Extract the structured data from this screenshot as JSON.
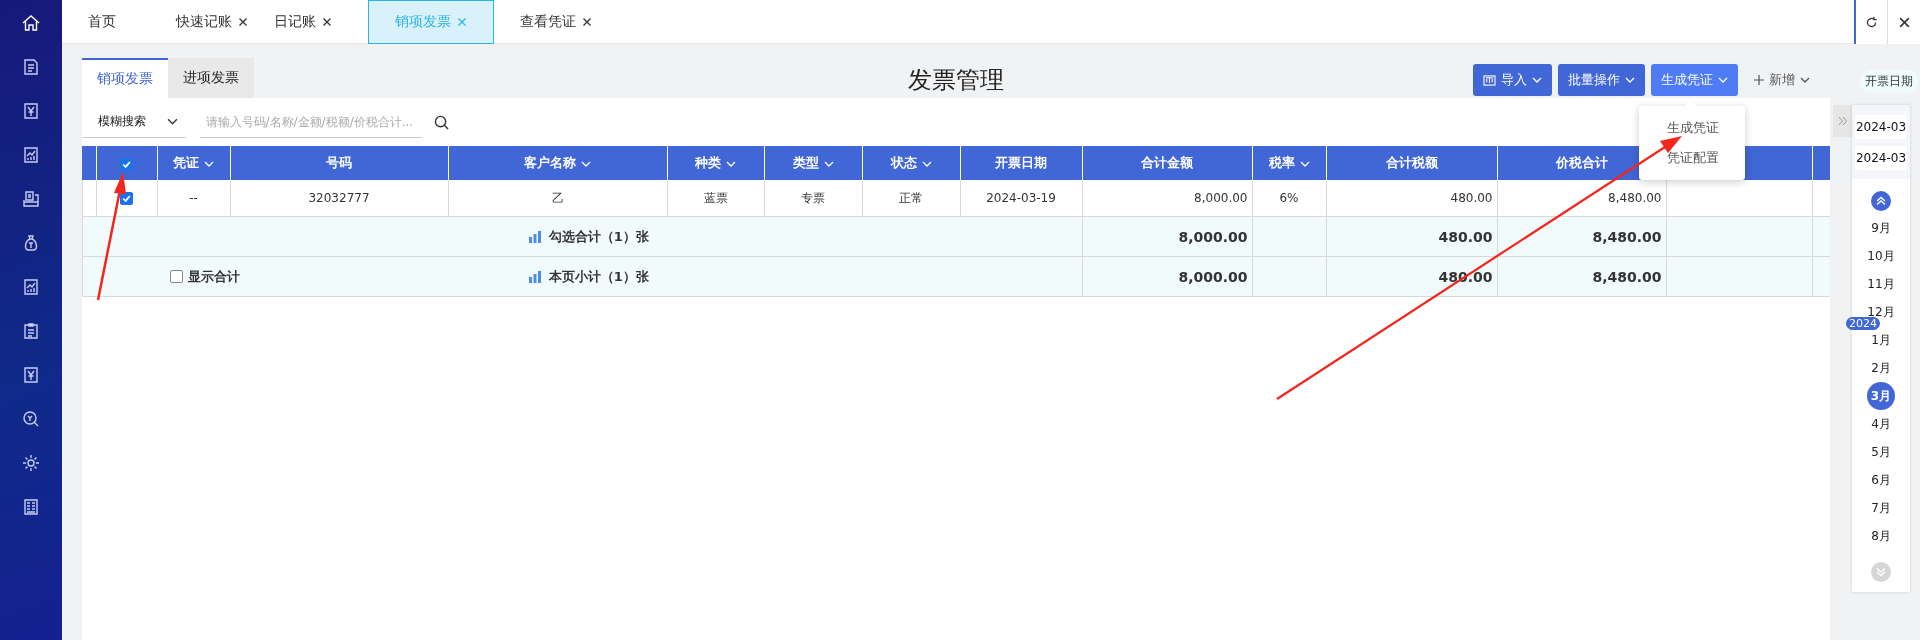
{
  "tabs": [
    {
      "label": "首页",
      "closable": false,
      "selected": false
    },
    {
      "label": "快速记账",
      "closable": true,
      "selected": false
    },
    {
      "label": "日记账",
      "closable": true,
      "selected": false
    },
    {
      "label": "销项发票",
      "closable": true,
      "selected": true
    },
    {
      "label": "查看凭证",
      "closable": true,
      "selected": false
    }
  ],
  "page_title": "发票管理",
  "sub_tabs": [
    {
      "label": "销项发票",
      "selected": true
    },
    {
      "label": "进项发票",
      "selected": false
    }
  ],
  "toolbar": [
    {
      "label": "导入",
      "kind": "import",
      "menu_open": false
    },
    {
      "label": "批量操作",
      "kind": "dropdown",
      "menu_open": false
    },
    {
      "label": "生成凭证",
      "kind": "dropdown",
      "menu_open": true
    },
    {
      "label": "新增",
      "kind": "add",
      "menu_open": false
    }
  ],
  "dropdown_menu": [
    "生成凭证",
    "凭证配置"
  ],
  "search": {
    "mode": "模糊搜索",
    "placeholder": "请输入号码/名称/金额/税额/价税合计..."
  },
  "table": {
    "header_checked": true,
    "columns": [
      {
        "label": "凭证",
        "filter": true
      },
      {
        "label": "号码",
        "filter": false
      },
      {
        "label": "客户名称",
        "filter": true
      },
      {
        "label": "种类",
        "filter": true
      },
      {
        "label": "类型",
        "filter": true
      },
      {
        "label": "状态",
        "filter": true
      },
      {
        "label": "开票日期",
        "filter": false
      },
      {
        "label": "合计金额",
        "filter": false
      },
      {
        "label": "税率",
        "filter": true
      },
      {
        "label": "合计税额",
        "filter": false
      },
      {
        "label": "价税合计",
        "filter": false
      }
    ],
    "rows": [
      {
        "checked": true,
        "cells": [
          "--",
          "32032777",
          "乙",
          "蓝票",
          "专票",
          "正常",
          "2024-03-19",
          "8,000.00",
          "6%",
          "480.00",
          "8,480.00"
        ]
      }
    ],
    "summaries": [
      {
        "label": "勾选合计（1）张",
        "amount": "8,000.00",
        "tax": "480.00",
        "total": "8,480.00"
      },
      {
        "label": "本页小计（1）张",
        "show_total": {
          "label": "显示合计",
          "checked": false
        },
        "amount": "8,000.00",
        "tax": "480.00",
        "total": "8,480.00"
      }
    ]
  },
  "date_filter": {
    "tooltip": "开票日期",
    "start": "2024-03",
    "end": "2024-03",
    "months": [
      {
        "label": "9月",
        "selected": false
      },
      {
        "label": "10月",
        "selected": false
      },
      {
        "label": "11月",
        "selected": false
      },
      {
        "label": "12月",
        "selected": false
      },
      {
        "label": "1月",
        "selected": false,
        "year": "2024"
      },
      {
        "label": "2月",
        "selected": false
      },
      {
        "label": "3月",
        "selected": true
      },
      {
        "label": "4月",
        "selected": false
      },
      {
        "label": "5月",
        "selected": false
      },
      {
        "label": "6月",
        "selected": false
      },
      {
        "label": "7月",
        "selected": false
      },
      {
        "label": "8月",
        "selected": false
      }
    ]
  }
}
